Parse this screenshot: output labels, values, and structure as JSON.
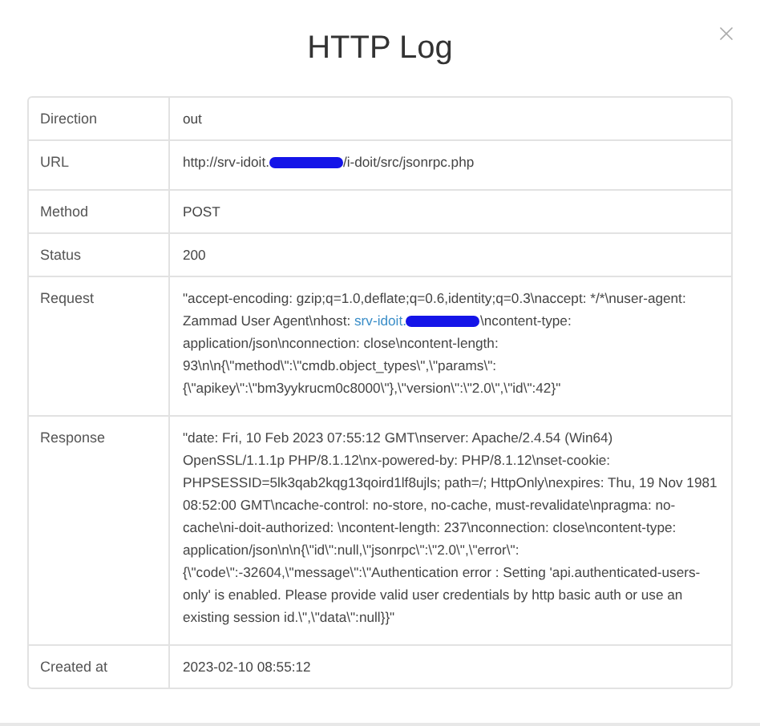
{
  "dialog": {
    "title": "HTTP Log"
  },
  "rows": [
    {
      "label": "Direction",
      "value": [
        {
          "kind": "text",
          "text": "out"
        }
      ]
    },
    {
      "label": "URL",
      "value": [
        {
          "kind": "text",
          "text": "http://srv-idoit."
        },
        {
          "kind": "redacted"
        },
        {
          "kind": "text",
          "text": "/i-doit/src/jsonrpc.php"
        }
      ]
    },
    {
      "label": "Method",
      "value": [
        {
          "kind": "text",
          "text": "POST"
        }
      ]
    },
    {
      "label": "Status",
      "value": [
        {
          "kind": "text",
          "text": "200"
        }
      ]
    },
    {
      "label": "Request",
      "value": [
        {
          "kind": "text",
          "text": "\"accept-encoding: gzip;q=1.0,deflate;q=0.6,identity;q=0.3\\naccept: */*\\nuser-agent: Zammad User Agent\\nhost: "
        },
        {
          "kind": "link",
          "text": "srv-idoit."
        },
        {
          "kind": "redacted"
        },
        {
          "kind": "text",
          "text": "\\ncontent-type: application/json\\nconnection: close\\ncontent-length: 93\\n\\n{\\\"method\\\":\\\"cmdb.object_types\\\",\\\"params\\\":{\\\"apikey\\\":\\\"bm3yykrucm0c8000\\\"},\\\"version\\\":\\\"2.0\\\",\\\"id\\\":42}\""
        }
      ]
    },
    {
      "label": "Response",
      "value": [
        {
          "kind": "text",
          "text": "\"date: Fri, 10 Feb 2023 07:55:12 GMT\\nserver: Apache/2.4.54 (Win64) OpenSSL/1.1.1p PHP/8.1.12\\nx-powered-by: PHP/8.1.12\\nset-cookie: PHPSESSID=5lk3qab2kqg13qoird1lf8ujls; path=/; HttpOnly\\nexpires: Thu, 19 Nov 1981 08:52:00 GMT\\ncache-control: no-store, no-cache, must-revalidate\\npragma: no-cache\\ni-doit-authorized: \\ncontent-length: 237\\nconnection: close\\ncontent-type: application/json\\n\\n{\\\"id\\\":null,\\\"jsonrpc\\\":\\\"2.0\\\",\\\"error\\\":{\\\"code\\\":-32604,\\\"message\\\":\\\"Authentication error : Setting 'api.authenticated-users-only' is enabled. Please provide valid user credentials by http basic auth or use an existing session id.\\\",\\\"data\\\":null}}\""
        }
      ]
    },
    {
      "label": "Created at",
      "value": [
        {
          "kind": "text",
          "text": "2023-02-10 08:55:12"
        }
      ]
    }
  ]
}
